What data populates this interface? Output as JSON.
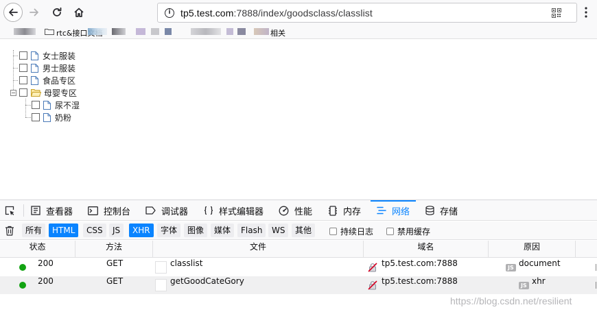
{
  "browser": {
    "url_host": "tp5.test.com",
    "url_rest": ":7888/index/goodsclass/classlist",
    "bookmark_label_1": "rtc&接口文档",
    "bookmark_label_2": "相关"
  },
  "tree": {
    "items": [
      {
        "label": "女士服装",
        "type": "file",
        "level": 0
      },
      {
        "label": "男士服装",
        "type": "file",
        "level": 0
      },
      {
        "label": "食品专区",
        "type": "file",
        "level": 0
      },
      {
        "label": "母婴专区",
        "type": "folder",
        "level": 0,
        "expanded": true
      },
      {
        "label": "尿不湿",
        "type": "file",
        "level": 1
      },
      {
        "label": "奶粉",
        "type": "file",
        "level": 1
      }
    ]
  },
  "devtools": {
    "tabs": [
      {
        "label": "查看器",
        "icon": "inspector-icon"
      },
      {
        "label": "控制台",
        "icon": "console-icon"
      },
      {
        "label": "调试器",
        "icon": "debugger-icon"
      },
      {
        "label": "样式编辑器",
        "icon": "style-editor-icon"
      },
      {
        "label": "性能",
        "icon": "performance-icon"
      },
      {
        "label": "内存",
        "icon": "memory-icon"
      },
      {
        "label": "网络",
        "icon": "network-icon",
        "active": true
      },
      {
        "label": "存储",
        "icon": "storage-icon"
      }
    ],
    "filters": [
      {
        "label": "所有",
        "active": false
      },
      {
        "label": "HTML",
        "active": true
      },
      {
        "label": "CSS",
        "active": false
      },
      {
        "label": "JS",
        "active": false
      },
      {
        "label": "XHR",
        "active": true
      },
      {
        "label": "字体",
        "active": false
      },
      {
        "label": "图像",
        "active": false
      },
      {
        "label": "媒体",
        "active": false
      },
      {
        "label": "Flash",
        "active": false
      },
      {
        "label": "WS",
        "active": false
      },
      {
        "label": "其他",
        "active": false
      }
    ],
    "persist_logs_label": "持续日志",
    "disable_cache_label": "禁用缓存",
    "columns": {
      "status": "状态",
      "method": "方法",
      "file": "文件",
      "domain": "域名",
      "cause": "原因"
    },
    "requests": [
      {
        "status": "200",
        "method": "GET",
        "file": "classlist",
        "domain": "tp5.test.com:7888",
        "cause_badge": "JS",
        "cause": "document"
      },
      {
        "status": "200",
        "method": "GET",
        "file": "getGoodCateGory",
        "domain": "tp5.test.com:7888",
        "cause_badge": "JS",
        "cause": "xhr"
      }
    ]
  },
  "watermark": "https://blog.csdn.net/resilient",
  "colors": {
    "accent": "#0a84ff",
    "status_ok": "#12a312"
  }
}
